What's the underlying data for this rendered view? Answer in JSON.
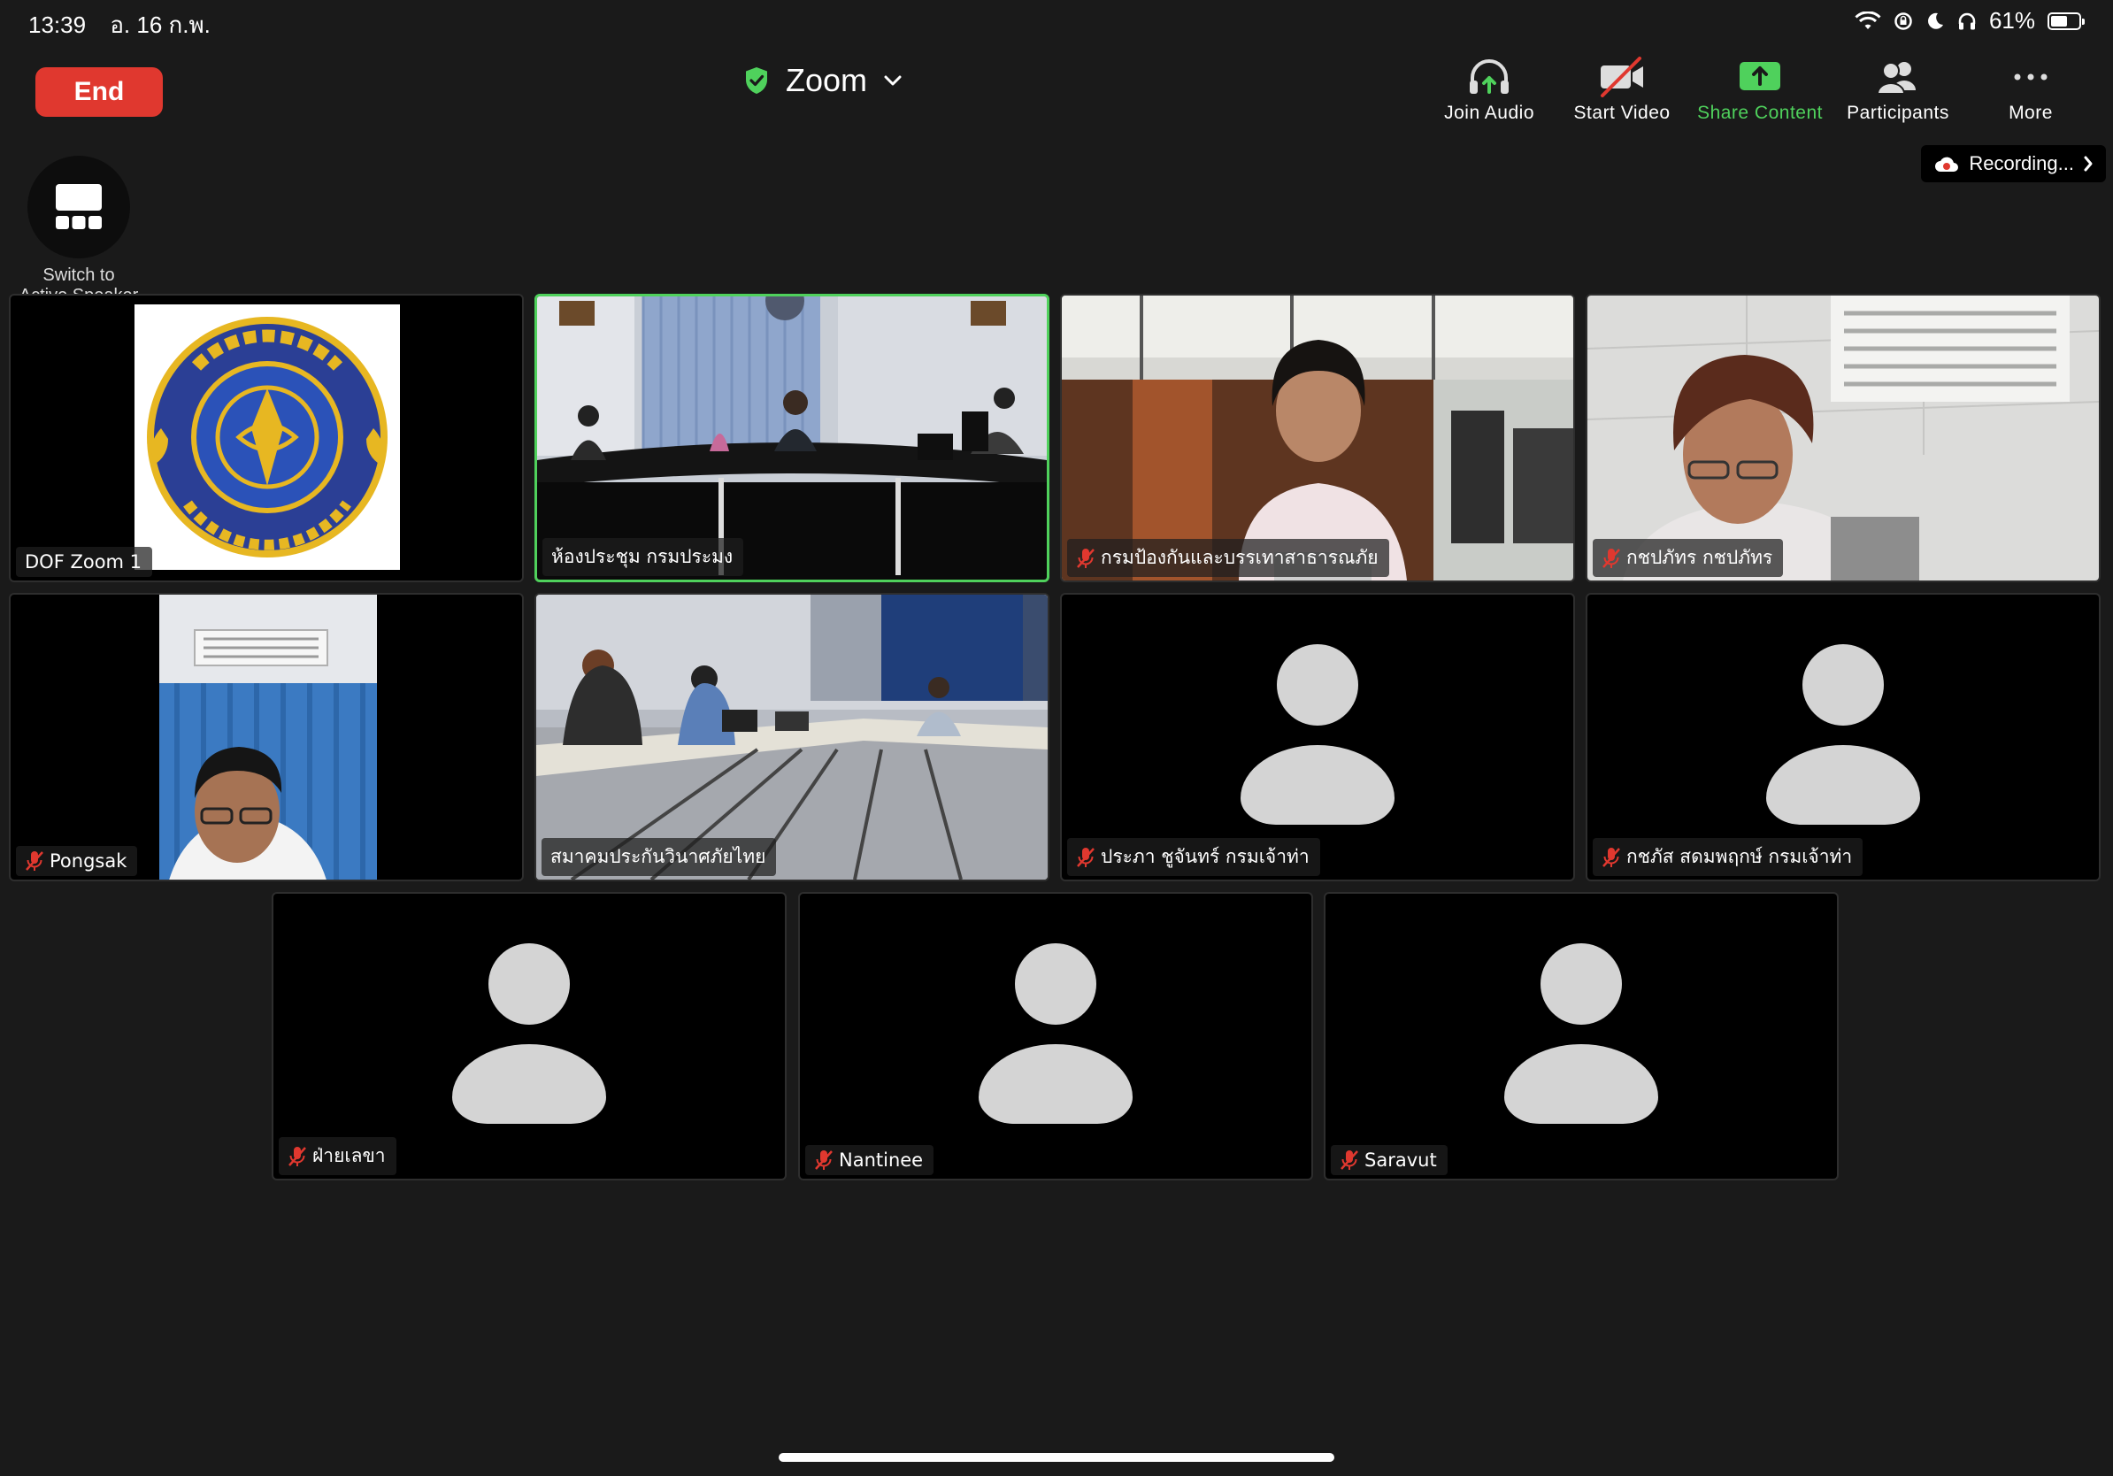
{
  "status_bar": {
    "time": "13:39",
    "date": "อ. 16 ก.พ.",
    "battery_text": "61%",
    "battery_level": 0.61
  },
  "meeting": {
    "end_label": "End",
    "title": "Zoom",
    "recording_label": "Recording..."
  },
  "toolbar": {
    "join_audio": "Join Audio",
    "start_video": "Start Video",
    "share_content": "Share Content",
    "participants": "Participants",
    "more": "More"
  },
  "switch_speaker": {
    "line1": "Switch to",
    "line2": "Active Speaker"
  },
  "colors": {
    "end_red": "#e0382f",
    "share_green": "#4fd15c",
    "active_border": "#4fd15c",
    "mute_red": "#e0382f"
  },
  "participants": [
    {
      "name": "DOF Zoom 1",
      "muted": false,
      "video": "logo"
    },
    {
      "name": "ห้องประชุม กรมประมง",
      "muted": false,
      "video": "meeting-room",
      "active": true
    },
    {
      "name": "กรมป้องกันและบรรเทาสาธารณภัย",
      "muted": true,
      "video": "woman-office"
    },
    {
      "name": "กชปภัทร กชปภัทร",
      "muted": true,
      "video": "woman-ceiling"
    },
    {
      "name": "Pongsak",
      "muted": true,
      "video": "man-curtain"
    },
    {
      "name": "สมาคมประกันวินาศภัยไทย",
      "muted": false,
      "video": "conference-room"
    },
    {
      "name": "ประภา ชูจันทร์  กรมเจ้าท่า",
      "muted": true,
      "video": "none"
    },
    {
      "name": "กชภัส สดมพฤกษ์ กรมเจ้าท่า",
      "muted": true,
      "video": "none"
    },
    {
      "name": "ฝ่ายเลขา",
      "muted": true,
      "video": "none"
    },
    {
      "name": "Nantinee",
      "muted": true,
      "video": "none"
    },
    {
      "name": "Saravut",
      "muted": true,
      "video": "none"
    }
  ]
}
